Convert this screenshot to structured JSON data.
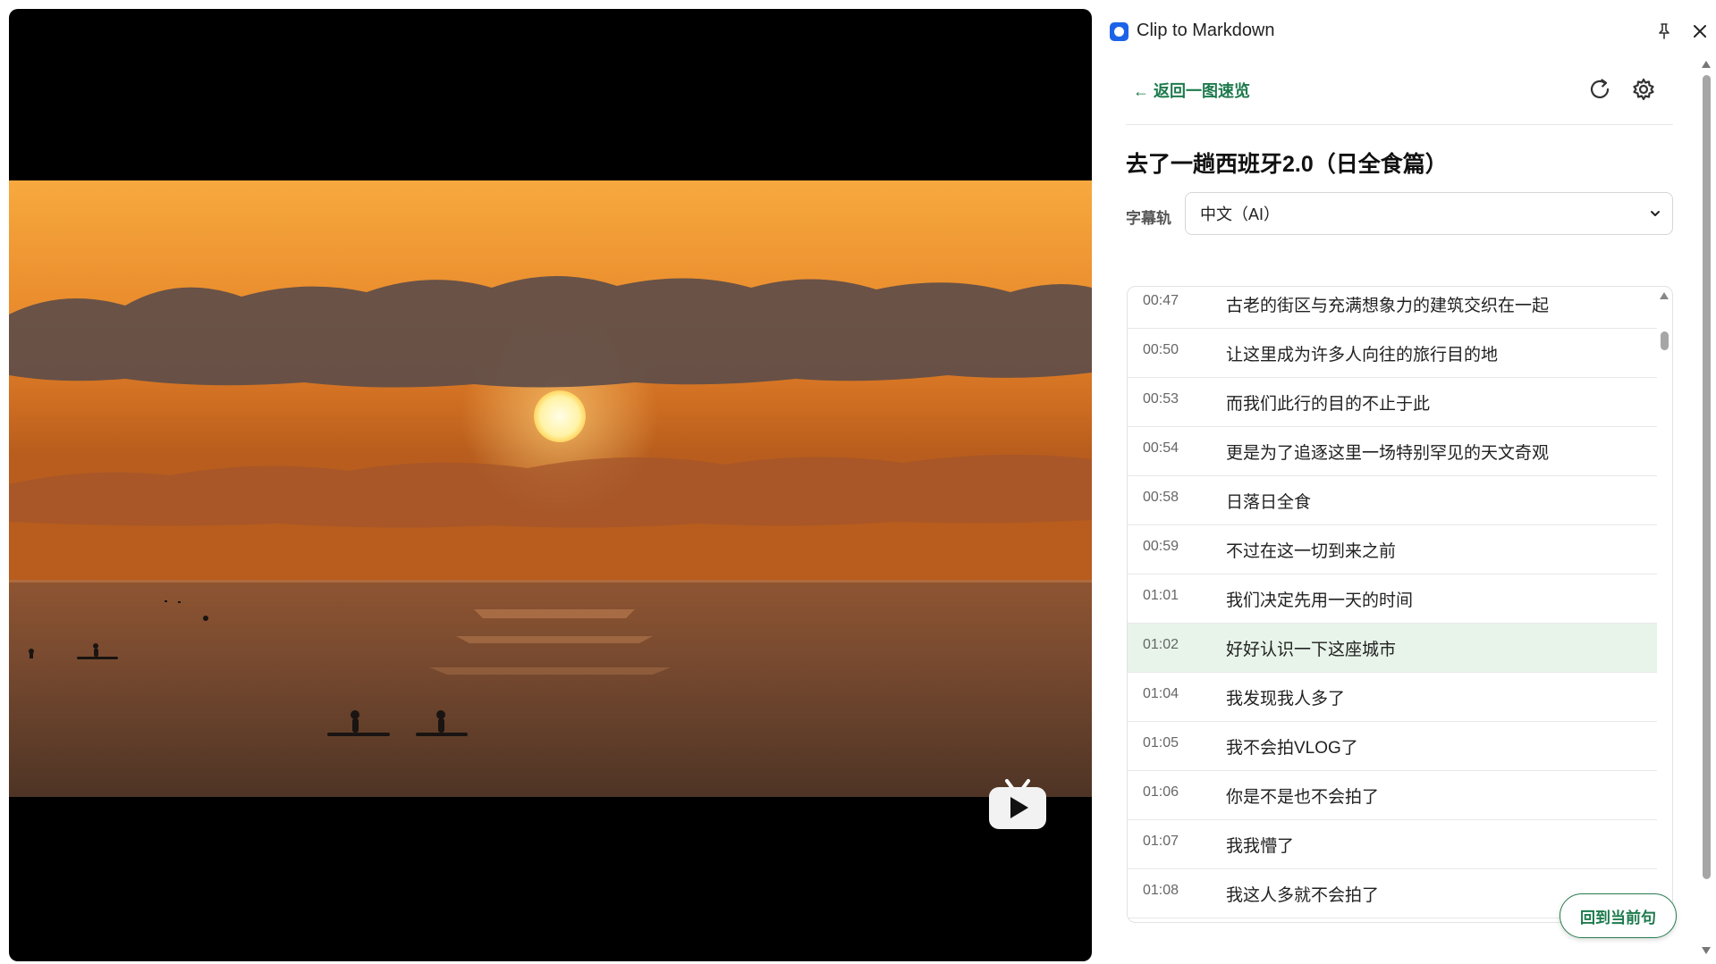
{
  "window": {
    "title": "Clip to Markdown",
    "icons": {
      "logo": "app-logo-icon",
      "pin": "pin-icon",
      "close": "close-icon"
    }
  },
  "nav": {
    "back_label": "← 返回一图速览",
    "refresh_icon": "refresh-icon",
    "settings_icon": "gear-icon"
  },
  "video": {
    "title": "去了一趟西班牙2.0（日全食篇）",
    "play_icon": "play-tv-icon"
  },
  "subtitle_track": {
    "label": "字幕轨",
    "selected": "中文（AI）"
  },
  "subtitles": [
    {
      "time": "00:47",
      "text": "古老的街区与充满想象力的建筑交织在一起",
      "active": false
    },
    {
      "time": "00:50",
      "text": "让这里成为许多人向往的旅行目的地",
      "active": false
    },
    {
      "time": "00:53",
      "text": "而我们此行的目的不止于此",
      "active": false
    },
    {
      "time": "00:54",
      "text": "更是为了追逐这里一场特别罕见的天文奇观",
      "active": false
    },
    {
      "time": "00:58",
      "text": "日落日全食",
      "active": false
    },
    {
      "time": "00:59",
      "text": "不过在这一切到来之前",
      "active": false
    },
    {
      "time": "01:01",
      "text": "我们决定先用一天的时间",
      "active": false
    },
    {
      "time": "01:02",
      "text": "好好认识一下这座城市",
      "active": true
    },
    {
      "time": "01:04",
      "text": "我发现我人多了",
      "active": false
    },
    {
      "time": "01:05",
      "text": "我不会拍VLOG了",
      "active": false
    },
    {
      "time": "01:06",
      "text": "你是不是也不会拍了",
      "active": false
    },
    {
      "time": "01:07",
      "text": "我我懵了",
      "active": false
    },
    {
      "time": "01:08",
      "text": "我这人多就不会拍了",
      "active": false
    }
  ],
  "actions": {
    "back_to_current": "回到当前句"
  },
  "colors": {
    "accent_green": "#1d7a4d",
    "active_row_bg": "#e8f4ea",
    "logo_blue": "#1d63e8"
  }
}
